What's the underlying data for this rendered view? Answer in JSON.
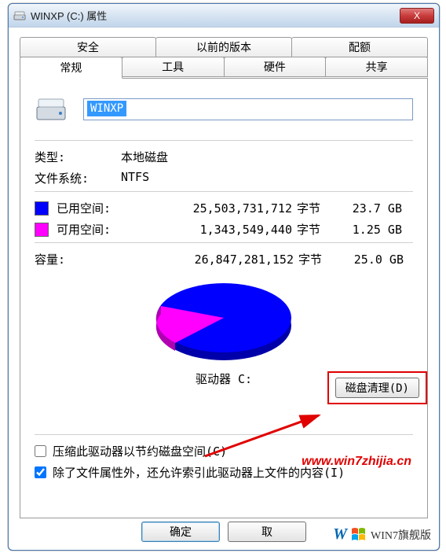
{
  "window": {
    "title": "WINXP (C:) 属性",
    "close": "X"
  },
  "tabs": {
    "back": [
      "安全",
      "以前的版本",
      "配额"
    ],
    "front": [
      "常规",
      "工具",
      "硬件",
      "共享"
    ],
    "active": "常规"
  },
  "general": {
    "drive_name": "WINXP",
    "type_label": "类型:",
    "type_value": "本地磁盘",
    "fs_label": "文件系统:",
    "fs_value": "NTFS",
    "used": {
      "label": "已用空间:",
      "bytes": "25,503,731,712",
      "unit": "字节",
      "gb": "23.7 GB",
      "color": "#0000ff"
    },
    "free": {
      "label": "可用空间:",
      "bytes": "1,343,549,440",
      "unit": "字节",
      "gb": "1.25 GB",
      "color": "#ff00ff"
    },
    "capacity": {
      "label": "容量:",
      "bytes": "26,847,281,152",
      "unit": "字节",
      "gb": "25.0 GB"
    },
    "drive_caption": "驱动器 C:",
    "cleanup_button": "磁盘清理(D)",
    "compress": {
      "label": "压缩此驱动器以节约磁盘空间(C)",
      "checked": false
    },
    "index": {
      "label": "除了文件属性外，还允许索引此驱动器上文件的内容(I)",
      "checked": true
    }
  },
  "buttons": {
    "ok": "确定",
    "cancel": "取"
  },
  "watermark": "www.win7zhijia.cn",
  "brand": {
    "prefix": "W",
    "text": "WIN7旗舰版"
  },
  "chart_data": {
    "type": "pie",
    "title": "驱动器 C:",
    "series": [
      {
        "name": "已用空间",
        "value": 25503731712,
        "gb": 23.7,
        "color": "#0000ff"
      },
      {
        "name": "可用空间",
        "value": 1343549440,
        "gb": 1.25,
        "color": "#ff00ff"
      }
    ],
    "total": {
      "bytes": 26847281152,
      "gb": 25.0
    }
  }
}
